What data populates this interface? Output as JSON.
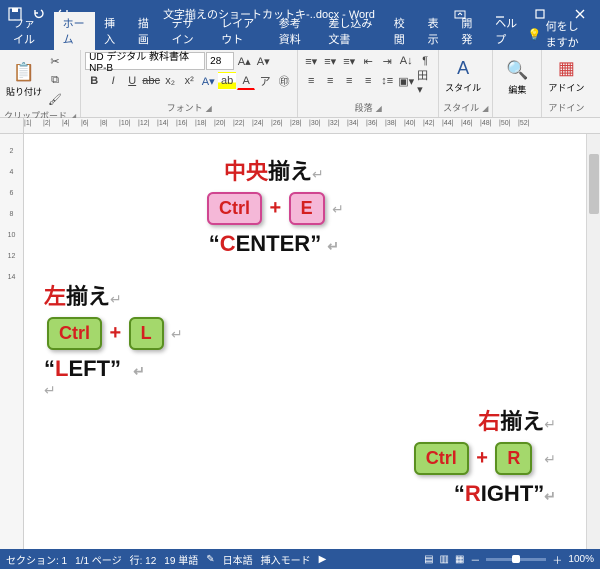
{
  "title": "文字揃えのショートカットキ-..docx - Word",
  "qat": {
    "save": "save-icon",
    "undo": "undo-icon",
    "redo": "redo-icon"
  },
  "tabs": [
    "ファイル",
    "ホーム",
    "挿入",
    "描画",
    "デザイン",
    "レイアウト",
    "参考資料",
    "差し込み文書",
    "校閲",
    "表示",
    "開発",
    "ヘルプ"
  ],
  "active_tab_index": 1,
  "tell_me": "何をしますか",
  "ribbon": {
    "clipboard": {
      "paste": "貼り付け",
      "label": "クリップボード"
    },
    "font": {
      "name": "UD デジタル 教科書体 NP-B",
      "size": "28",
      "label": "フォント"
    },
    "paragraph": {
      "label": "段落"
    },
    "styles": {
      "btn": "スタイル",
      "label": "スタイル"
    },
    "editing": {
      "btn": "編集",
      "label": ""
    },
    "addin": {
      "btn": "アドイン",
      "label": "アドイン"
    }
  },
  "document": {
    "center": {
      "title_red": "中央",
      "title_blk": "揃え",
      "key1": "Ctrl",
      "key2": "E",
      "eng_first": "C",
      "eng_rest": "ENTER"
    },
    "left": {
      "title_red": "左",
      "title_blk": "揃え",
      "key1": "Ctrl",
      "key2": "L",
      "eng_first": "L",
      "eng_rest": "EFT"
    },
    "right": {
      "title_red": "右",
      "title_blk": "揃え",
      "key1": "Ctrl",
      "key2": "R",
      "eng_first": "R",
      "eng_rest": "IGHT"
    },
    "quote_open": "“",
    "quote_close": "”",
    "return": "↵"
  },
  "status": {
    "section": "セクション: 1",
    "page": "1/1 ページ",
    "line": "行: 12",
    "words": "19 単語",
    "lang": "日本語",
    "mode": "挿入モード",
    "zoom": "100%"
  },
  "ruler_nums": [
    1,
    2,
    4,
    6,
    8,
    10,
    12,
    14,
    16,
    18,
    20,
    22,
    24,
    26,
    28,
    30,
    32,
    34,
    36,
    38,
    40,
    42,
    44,
    46,
    48,
    50,
    52
  ],
  "vruler_nums": [
    2,
    4,
    6,
    8,
    10,
    12,
    14
  ]
}
